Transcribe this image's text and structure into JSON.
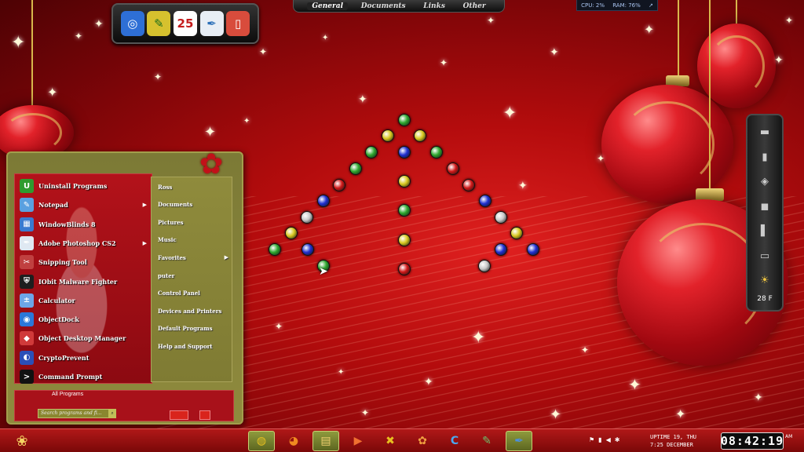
{
  "colors": {
    "desktop_red": "#b40c0d",
    "menu_olive": "#8f8a3d",
    "menu_red": "#a8111a",
    "gold": "#d8b84c"
  },
  "top_dock": {
    "icons": [
      {
        "name": "google-earth-icon",
        "glyph": "◎",
        "bg": "#2e6fd6",
        "fg": "#ffffff"
      },
      {
        "name": "paint-bucket-icon",
        "glyph": "✎",
        "bg": "#d6c12e",
        "fg": "#1a6b1a"
      },
      {
        "name": "calendar-icon",
        "glyph": "25",
        "bg": "#ffffff",
        "fg": "#c41c1c"
      },
      {
        "name": "feather-pen-icon",
        "glyph": "✒",
        "bg": "#e8eef5",
        "fg": "#2b6fb8"
      },
      {
        "name": "window-frame-icon",
        "glyph": "▯",
        "bg": "#d84c3c",
        "fg": "#ffffff"
      }
    ]
  },
  "top_nav": {
    "items": [
      "General",
      "Documents",
      "Links",
      "Other"
    ],
    "active": "General"
  },
  "sysmon": {
    "cpu": "CPU: 2%",
    "ram": "RAM: 76%",
    "arrow": "↗"
  },
  "start_menu": {
    "programs": [
      {
        "label": "Uninstall Programs",
        "icon": "uninstall-icon",
        "glyph": "U",
        "bg": "#2f9b2f",
        "submenu": false
      },
      {
        "label": "Notepad",
        "icon": "notepad-icon",
        "glyph": "✎",
        "bg": "#5aa0e0",
        "submenu": true
      },
      {
        "label": "WindowBlinds 8",
        "icon": "windowblinds-icon",
        "glyph": "▦",
        "bg": "#3a7ad0",
        "submenu": false
      },
      {
        "label": "Adobe Photoshop CS2",
        "icon": "photoshop-feather-icon",
        "glyph": "✒",
        "bg": "#dfe8f2",
        "submenu": true
      },
      {
        "label": "Snipping Tool",
        "icon": "scissors-icon",
        "glyph": "✂",
        "bg": "#c04040",
        "submenu": false
      },
      {
        "label": "IObit Malware Fighter",
        "icon": "shield-icon",
        "glyph": "⛨",
        "bg": "#1e1e1e",
        "submenu": false
      },
      {
        "label": "Calculator",
        "icon": "calculator-icon",
        "glyph": "±",
        "bg": "#6da6e8",
        "submenu": false
      },
      {
        "label": "ObjectDock",
        "icon": "objectdock-icon",
        "glyph": "◉",
        "bg": "#2b78d8",
        "submenu": false
      },
      {
        "label": "Object Desktop Manager",
        "icon": "cube-icon",
        "glyph": "◆",
        "bg": "#d03a3a",
        "submenu": false
      },
      {
        "label": "CryptoPrevent",
        "icon": "cryptoprevent-icon",
        "glyph": "◐",
        "bg": "#2b4fb8",
        "submenu": false
      },
      {
        "label": "Command Prompt",
        "icon": "terminal-icon",
        "glyph": ">",
        "bg": "#111111",
        "submenu": false
      }
    ],
    "places": [
      {
        "label": "Ross",
        "submenu": false
      },
      {
        "label": "Documents",
        "submenu": false
      },
      {
        "label": "Pictures",
        "submenu": false
      },
      {
        "label": "Music",
        "submenu": false
      },
      {
        "label": "Favorites",
        "submenu": true
      },
      {
        "label": "puter",
        "submenu": false
      },
      {
        "label": "Control Panel",
        "submenu": false
      },
      {
        "label": "Devices and Printers",
        "submenu": false
      },
      {
        "label": "Default Programs",
        "submenu": false
      },
      {
        "label": "Help and Support",
        "submenu": false
      }
    ],
    "all_programs": "All Programs",
    "search_placeholder": "Search programs and fi..."
  },
  "right_dock": {
    "icons": [
      {
        "name": "monitor-icon",
        "glyph": "▬"
      },
      {
        "name": "usb-drive-icon",
        "glyph": "▮"
      },
      {
        "name": "cube-box-icon",
        "glyph": "◈"
      },
      {
        "name": "device-icon",
        "glyph": "◼"
      },
      {
        "name": "tower-icon",
        "glyph": "▌"
      },
      {
        "name": "recycle-bin-icon",
        "glyph": "▭"
      }
    ],
    "weather_temp": "28 F"
  },
  "taskbar": {
    "buttons": [
      {
        "name": "chrome-icon",
        "glyph": "◍",
        "fg": "#e8c020",
        "bg": "#c0392b",
        "active": true
      },
      {
        "name": "firefox-icon",
        "glyph": "◕",
        "fg": "#f08a20",
        "bg": "",
        "active": false
      },
      {
        "name": "file-explorer-icon",
        "glyph": "▤",
        "fg": "#f0d070",
        "bg": "",
        "active": true
      },
      {
        "name": "media-player-icon",
        "glyph": "▶",
        "fg": "#f07030",
        "bg": "",
        "active": false
      },
      {
        "name": "tools-icon",
        "glyph": "✖",
        "fg": "#e8c020",
        "bg": "",
        "active": false
      },
      {
        "name": "paint-icon",
        "glyph": "✿",
        "fg": "#f0a040",
        "bg": "",
        "active": false
      },
      {
        "name": "ccleaner-icon",
        "glyph": "C",
        "fg": "#4aa8f0",
        "bg": "",
        "active": false
      },
      {
        "name": "notepad-task-icon",
        "glyph": "✎",
        "fg": "#6cc06c",
        "bg": "",
        "active": false
      },
      {
        "name": "feather-task-icon",
        "glyph": "✒",
        "fg": "#4a90e0",
        "bg": "",
        "active": true
      }
    ],
    "uptime_line1": "UPTIME  19, THU",
    "uptime_line2": "7:25  DECEMBER",
    "clock": "08:42:19",
    "ampm": "AM"
  }
}
